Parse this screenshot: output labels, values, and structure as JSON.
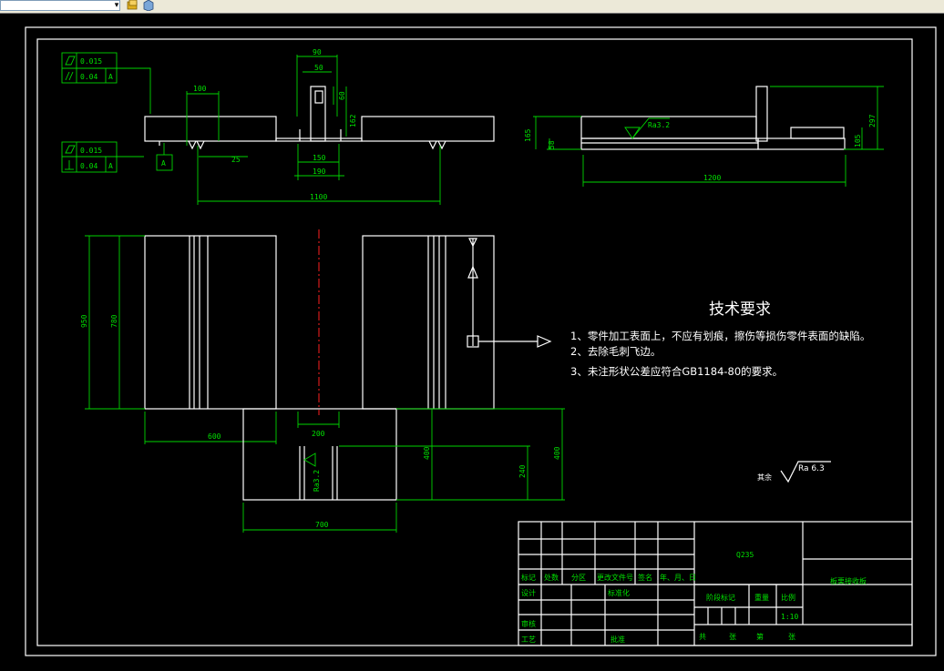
{
  "toolbar": {
    "combo_value": "",
    "icons": [
      "layer-stack-icon",
      "cube-icon"
    ]
  },
  "colors": {
    "background": "#000000",
    "geometry": "#ffffff",
    "dimension": "#00d400",
    "centerline": "#ff2020"
  },
  "tolerances": {
    "top": [
      {
        "symbol": "flatness",
        "value": "0.015",
        "datum": ""
      },
      {
        "symbol": "parallelism",
        "value": "0.04",
        "datum": "A"
      }
    ],
    "bottom": [
      {
        "symbol": "flatness",
        "value": "0.015",
        "datum": ""
      },
      {
        "symbol": "perpendicularity",
        "value": "0.04",
        "datum": "A"
      }
    ],
    "datum_label": "A"
  },
  "dimensions": {
    "front": {
      "d90": "90",
      "d50": "50",
      "d60": "60",
      "d162": "162",
      "d100": "100",
      "d25": "25",
      "d150": "150",
      "d190": "190",
      "d1100": "1100"
    },
    "side": {
      "d165": "165",
      "d58": "58",
      "d1200": "1200",
      "d105": "105",
      "d297": "297",
      "roughness": "Ra3.2"
    },
    "plan": {
      "d950": "950",
      "d780": "780",
      "d600": "600",
      "d200": "200",
      "d400a": "400",
      "d240": "240",
      "d400b": "400",
      "d700": "700",
      "roughness": "Ra3.2"
    }
  },
  "requirements": {
    "title": "技术要求",
    "items": [
      "1、零件加工表面上，不应有划痕，擦伤等损伤零件表面的缺陷。",
      "2、去除毛刺飞边。",
      "3、未注形状公差应符合GB1184-80的要求。"
    ]
  },
  "roughness_note": {
    "prefix": "其余",
    "value": "Ra 6.3"
  },
  "title_block": {
    "material": "Q235",
    "part_name": "板栗接收板",
    "row_labels": [
      "标记",
      "处数",
      "分区",
      "更改文件号",
      "签名",
      "年、月、日"
    ],
    "design": "设计",
    "standardization": "标准化",
    "check": "审核",
    "process": "工艺",
    "approve": "批准",
    "stage_mark": "阶段标记",
    "weight": "重量",
    "scale": "比例",
    "scale_value": "1:10",
    "total": "共",
    "sheets": "张",
    "page": "第",
    "sheet": "张"
  }
}
